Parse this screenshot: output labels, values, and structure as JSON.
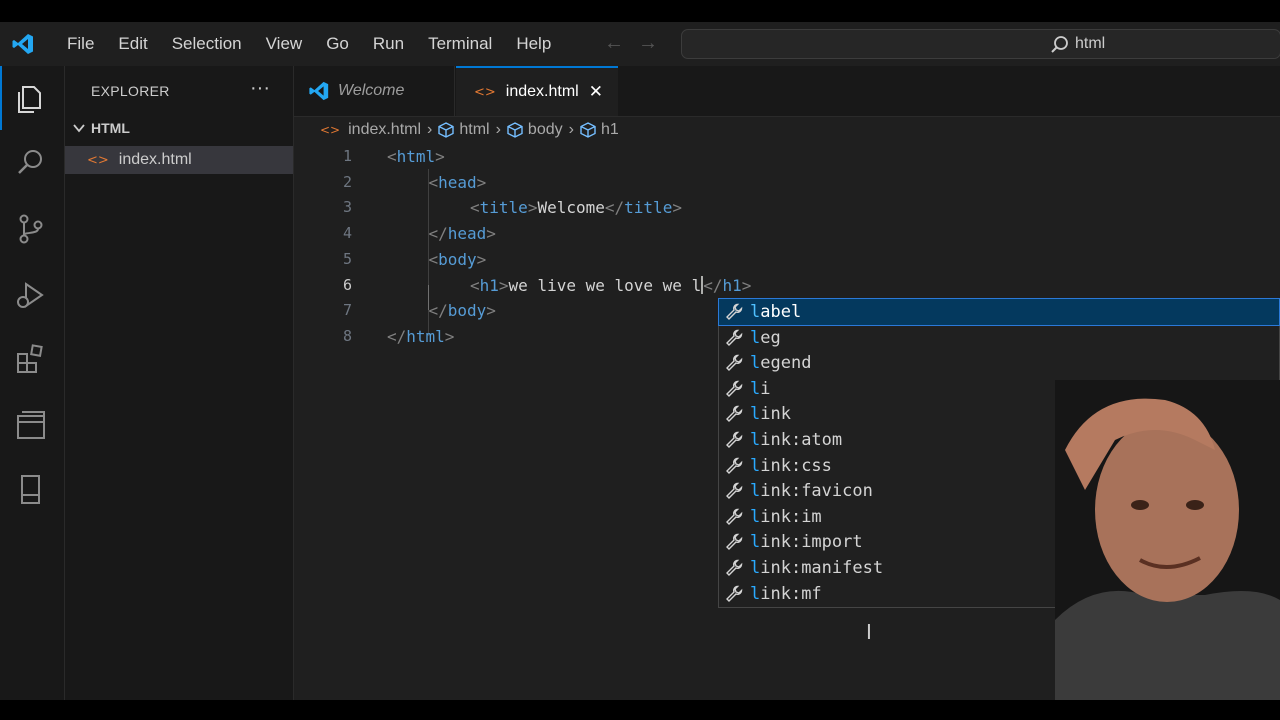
{
  "menu": [
    "File",
    "Edit",
    "Selection",
    "View",
    "Go",
    "Run",
    "Terminal",
    "Help"
  ],
  "search": {
    "text": "html"
  },
  "explorer": {
    "title": "EXPLORER",
    "more": "···",
    "folder": "HTML",
    "file": "index.html"
  },
  "tabs": [
    {
      "label": "Welcome"
    },
    {
      "label": "index.html",
      "close": "✕"
    }
  ],
  "breadcrumb": [
    "index.html",
    "html",
    "body",
    "h1"
  ],
  "editor": {
    "line_numbers": [
      "1",
      "2",
      "3",
      "4",
      "5",
      "6",
      "7",
      "8"
    ],
    "lines": [
      {
        "indent": 0,
        "open": "<",
        "tag": "html",
        "close": ">",
        "text": ""
      },
      {
        "indent": 1,
        "open": "<",
        "tag": "head",
        "close": ">",
        "text": ""
      },
      {
        "indent": 2,
        "open": "<",
        "tag": "title",
        "close": ">",
        "text": "Welcome",
        "end_open": "</",
        "end_tag": "title",
        "end_close": ">"
      },
      {
        "indent": 1,
        "open": "</",
        "tag": "head",
        "close": ">",
        "text": ""
      },
      {
        "indent": 1,
        "open": "<",
        "tag": "body",
        "close": ">",
        "text": ""
      },
      {
        "indent": 2,
        "open": "<",
        "tag": "h1",
        "close": ">",
        "text": "we live we love we l",
        "end_open": "</",
        "end_tag": "h1",
        "end_close": ">"
      },
      {
        "indent": 1,
        "open": "</",
        "tag": "body",
        "close": ">",
        "text": ""
      },
      {
        "indent": 0,
        "open": "</",
        "tag": "html",
        "close": ">",
        "text": ""
      }
    ]
  },
  "suggestions": [
    {
      "match": "l",
      "rest": "abel"
    },
    {
      "match": "l",
      "rest": "eg"
    },
    {
      "match": "l",
      "rest": "egend"
    },
    {
      "match": "l",
      "rest": "i"
    },
    {
      "match": "l",
      "rest": "ink"
    },
    {
      "match": "l",
      "rest": "ink:atom"
    },
    {
      "match": "l",
      "rest": "ink:css"
    },
    {
      "match": "l",
      "rest": "ink:favicon"
    },
    {
      "match": "l",
      "rest": "ink:im"
    },
    {
      "match": "l",
      "rest": "ink:import"
    },
    {
      "match": "l",
      "rest": "ink:manifest"
    },
    {
      "match": "l",
      "rest": "ink:mf"
    }
  ],
  "colors": {
    "accent": "#0078d4",
    "tag": "#569cd6",
    "punct": "#808080",
    "match": "#2aaaff",
    "html_icon": "#e37933"
  }
}
